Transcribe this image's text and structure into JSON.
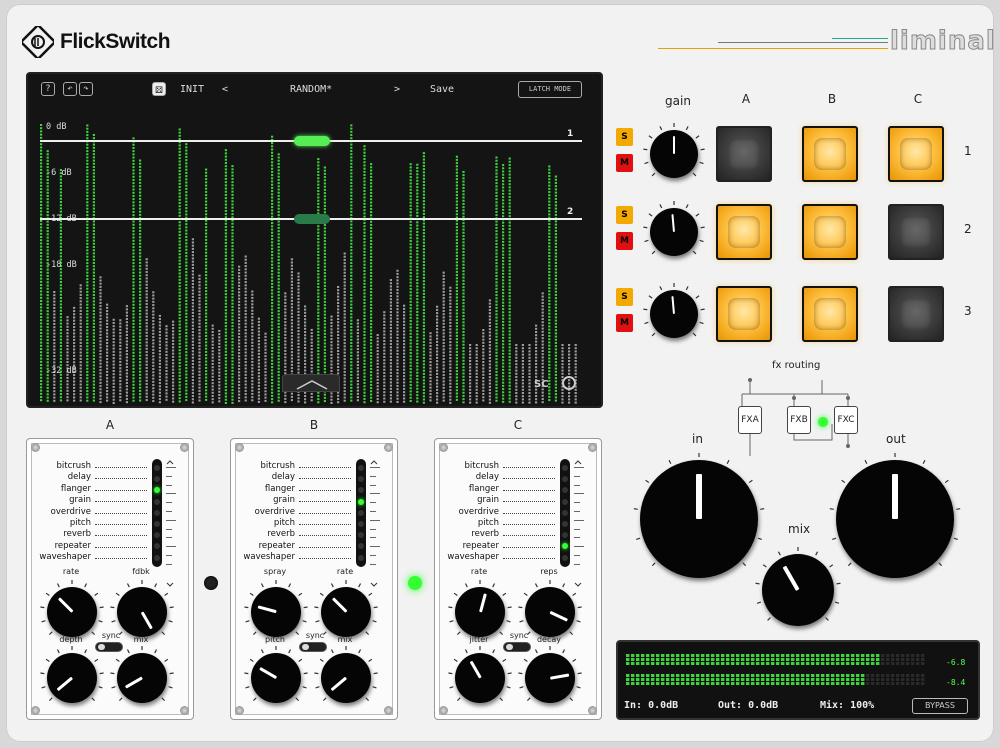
{
  "brand": {
    "name": "FlickSwitch",
    "product": "liminal"
  },
  "colors": {
    "green": "#3bd43b",
    "pad_on": "#ffb020",
    "s_button": "#f2a900",
    "m_button": "#e01010"
  },
  "screen": {
    "help_label": "?",
    "undo_label": "↶",
    "redo_label": "↷",
    "dice_label": "⚄",
    "preset_init": "INIT",
    "prev_label": "<",
    "preset_name": "RANDOM*",
    "next_label": ">",
    "save_label": "Save",
    "latch_label": "LATCH MODE",
    "db_labels": [
      "0 dB",
      "-6 dB",
      "-12 dB",
      "-18 dB",
      "-32 dB"
    ],
    "threshold_1": "1",
    "threshold_2": "2",
    "sc_label": "SC"
  },
  "chart_data": {
    "type": "bar",
    "title": "",
    "y_labels": [
      "0 dB",
      "-6 dB",
      "-12 dB",
      "-18 dB",
      "-32 dB"
    ],
    "threshold_labels": [
      "1",
      "2"
    ],
    "ylim": [
      -32,
      0
    ]
  },
  "panels": [
    {
      "title": "A",
      "fx": [
        "bitcrush",
        "delay",
        "flanger",
        "grain",
        "overdrive",
        "pitch",
        "reverb",
        "repeater",
        "waveshaper"
      ],
      "active": 2,
      "knob_labels": [
        "rate",
        "fdbk",
        "depth",
        "mix"
      ],
      "sync_label": "sync"
    },
    {
      "title": "B",
      "fx": [
        "bitcrush",
        "delay",
        "flanger",
        "grain",
        "overdrive",
        "pitch",
        "reverb",
        "repeater",
        "waveshaper"
      ],
      "active": 3,
      "knob_labels": [
        "spray",
        "rate",
        "pitch",
        "mix"
      ],
      "sync_label": "sync"
    },
    {
      "title": "C",
      "fx": [
        "bitcrush",
        "delay",
        "flanger",
        "grain",
        "overdrive",
        "pitch",
        "reverb",
        "repeater",
        "waveshaper"
      ],
      "active": 7,
      "knob_labels": [
        "rate",
        "reps",
        "jitter",
        "decay"
      ],
      "sync_label": "sync"
    }
  ],
  "matrix": {
    "gain_label": "gain",
    "columns": [
      "A",
      "B",
      "C"
    ],
    "rows": [
      "1",
      "2",
      "3"
    ],
    "s_label": "S",
    "m_label": "M",
    "pads": [
      [
        false,
        true,
        true
      ],
      [
        true,
        true,
        false
      ],
      [
        true,
        true,
        false
      ]
    ]
  },
  "routing": {
    "title": "fx routing",
    "boxes": [
      "FXA",
      "FXB",
      "FXC"
    ]
  },
  "main": {
    "in_label": "in",
    "out_label": "out",
    "mix_label": "mix"
  },
  "meter": {
    "in_text": "In: 0.0dB",
    "out_text": "Out: 0.0dB",
    "mix_text": "Mix: 100%",
    "bypass_label": "BYPASS",
    "val_1": "-6.8",
    "val_2": "-8.4",
    "level_1": 0.85,
    "level_2": 0.79
  }
}
